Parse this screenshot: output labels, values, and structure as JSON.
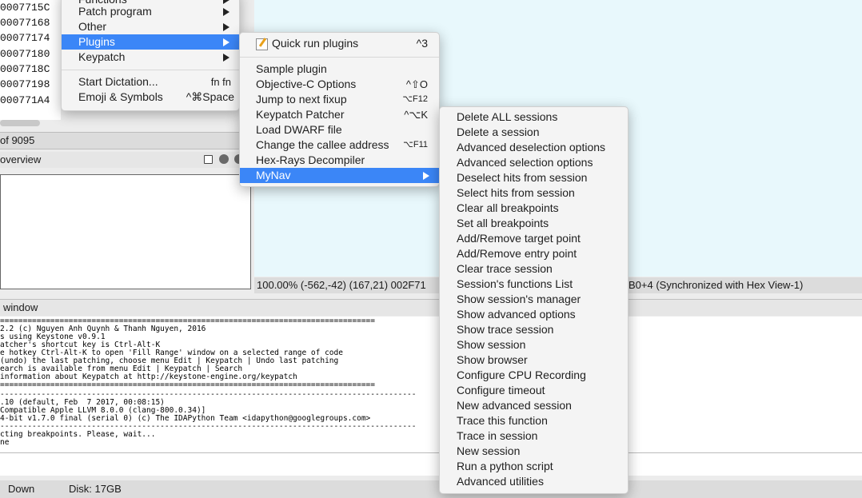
{
  "addresses": [
    "0007715C",
    "00077168",
    "00077174",
    "00077180",
    "0007718C",
    "00077198",
    "000771A4"
  ],
  "status_count": "of 9095",
  "overview_title": "overview",
  "graph_status": "100.00% (-562,-42) (167,21) 002F71",
  "graph_status_tail": "B0+4 (Synchronized with Hex View-1)",
  "output_title": "window",
  "output_lines": [
    "==================================================================================",
    "2.2 (c) Nguyen Anh Quynh & Thanh Nguyen, 2016",
    "s using Keystone v0.9.1",
    "atcher's shortcut key is Ctrl-Alt-K",
    "e hotkey Ctrl-Alt-K to open 'Fill Range' window on a selected range of code",
    "(undo) the last patching, choose menu Edit | Keypatch | Undo last patching",
    "earch is available from menu Edit | Keypatch | Search",
    "information about Keypatch at http://keystone-engine.org/keypatch",
    "==================================================================================",
    "-------------------------------------------------------------------------------------------",
    ".10 (default, Feb  7 2017, 00:08:15)",
    "Compatible Apple LLVM 8.0.0 (clang-800.0.34)]",
    "4-bit v1.7.0 final (serial 0) (c) The IDAPython Team <idapython@googlegroups.com>",
    "-------------------------------------------------------------------------------------------",
    "cting breakpoints. Please, wait...",
    "ne"
  ],
  "bottom_status": {
    "state": "Down",
    "disk": "Disk: 17GB"
  },
  "menu_edit": {
    "items": [
      {
        "label": "Functions",
        "submenu": true
      },
      {
        "label": "Patch program",
        "submenu": true
      },
      {
        "label": "Other",
        "submenu": true
      },
      {
        "label": "Plugins",
        "submenu": true,
        "selected": true
      },
      {
        "label": "Keypatch",
        "submenu": true
      },
      {
        "label": "Start Dictation...",
        "shortcut": "fn fn"
      },
      {
        "label": "Emoji & Symbols",
        "shortcut": "^⌘Space"
      }
    ]
  },
  "menu_plugins": {
    "items": [
      {
        "label": "Quick run plugins",
        "shortcut": "^3",
        "icon": "quick-run-icon"
      },
      {
        "label": "Sample plugin",
        "shortcut": ""
      },
      {
        "label": "Objective-C Options",
        "shortcut": "^⇧O"
      },
      {
        "label": "Jump to next fixup",
        "shortcut": "⌥F12"
      },
      {
        "label": "Keypatch Patcher",
        "shortcut": "^⌥K"
      },
      {
        "label": "Load DWARF file",
        "shortcut": ""
      },
      {
        "label": "Change the callee address",
        "shortcut": "⌥F11"
      },
      {
        "label": "Hex-Rays Decompiler",
        "shortcut": ""
      },
      {
        "label": "MyNav",
        "submenu": true,
        "selected": true
      }
    ]
  },
  "menu_mynav": {
    "items": [
      "Delete ALL sessions",
      "Delete a session",
      "Advanced deselection options",
      "Advanced selection options",
      "Deselect hits from session",
      "Select hits from session",
      "Clear all breakpoints",
      "Set all breakpoints",
      "Add/Remove target point",
      "Add/Remove entry point",
      "Clear trace session",
      "Session's functions List",
      "Show session's manager",
      "Show advanced options",
      "Show trace session",
      "Show session",
      "Show browser",
      "Configure CPU Recording",
      "Configure timeout",
      "New advanced session",
      "Trace this function",
      "Trace in session",
      "New session",
      "Run a python script",
      "Advanced utilities"
    ]
  },
  "colors": {
    "selection": "#3b86f7",
    "graph_bg": "#e8f8fc"
  }
}
